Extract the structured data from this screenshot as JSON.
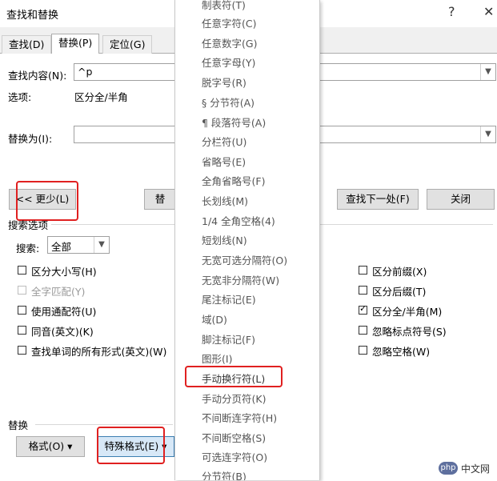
{
  "window": {
    "title": "查找和替换",
    "help": "?",
    "close": "✕"
  },
  "tabs": [
    "查找(D)",
    "替换(P)",
    "定位(G)"
  ],
  "find": {
    "label": "查找内容(N):",
    "value": "^p",
    "options_label": "选项:",
    "options_value": "区分全/半角"
  },
  "replace": {
    "label": "替换为(I):",
    "value": ""
  },
  "buttons": {
    "less": "<< 更少(L)",
    "replace_partial": "替",
    "find_next": "查找下一处(F)",
    "close": "关闭"
  },
  "search_options": {
    "heading": "搜索选项",
    "search_label": "搜索:",
    "search_value": "全部",
    "left": [
      {
        "label": "区分大小写(H)",
        "checked": false,
        "disabled": false
      },
      {
        "label": "全字匹配(Y)",
        "checked": false,
        "disabled": true
      },
      {
        "label": "使用通配符(U)",
        "checked": false,
        "disabled": false
      },
      {
        "label": "同音(英文)(K)",
        "checked": false,
        "disabled": false
      },
      {
        "label": "查找单词的所有形式(英文)(W)",
        "checked": false,
        "disabled": false
      }
    ],
    "right": [
      {
        "label": "区分前缀(X)",
        "checked": false
      },
      {
        "label": "区分后缀(T)",
        "checked": false
      },
      {
        "label": "区分全/半角(M)",
        "checked": true
      },
      {
        "label": "忽略标点符号(S)",
        "checked": false
      },
      {
        "label": "忽略空格(W)",
        "checked": false
      }
    ]
  },
  "replace_section": {
    "heading": "替换",
    "format_button": "格式(O) ▾",
    "special_button": "特殊格式(E) ▾"
  },
  "menu": {
    "items": [
      "制表符(T)",
      "任意字符(C)",
      "任意数字(G)",
      "任意字母(Y)",
      "脱字号(R)",
      "§ 分节符(A)",
      "¶ 段落符号(A)",
      "分栏符(U)",
      "省略号(E)",
      "全角省略号(F)",
      "长划线(M)",
      "1/4 全角空格(4)",
      "短划线(N)",
      "无宽可选分隔符(O)",
      "无宽非分隔符(W)",
      "尾注标记(E)",
      "域(D)",
      "脚注标记(F)",
      "图形(I)",
      "手动换行符(L)",
      "手动分页符(K)",
      "不间断连字符(H)",
      "不间断空格(S)",
      "可选连字符(O)",
      "分节符(B)"
    ],
    "highlighted_index": 19
  },
  "watermark": {
    "text": "中文网",
    "logo": "php"
  },
  "colors": {
    "highlight": "#e02020"
  }
}
